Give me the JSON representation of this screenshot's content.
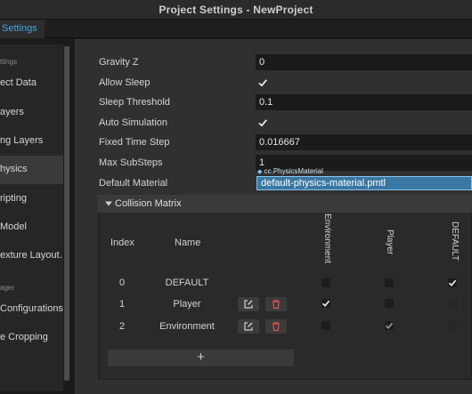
{
  "window": {
    "title": "Project Settings - NewProject"
  },
  "tab": {
    "label": "Settings"
  },
  "sidebar": {
    "section_project": "ttings",
    "section_manager": "ager",
    "items": [
      {
        "label": "ect Data"
      },
      {
        "label": "ayers"
      },
      {
        "label": "ng Layers"
      },
      {
        "label": "hysics"
      },
      {
        "label": "ripting"
      },
      {
        "label": "Model"
      },
      {
        "label": "exture Layout…"
      },
      {
        "label": " Configurations…"
      },
      {
        "label": "e Cropping"
      }
    ],
    "active_index": 3
  },
  "physics": {
    "gravity_z": {
      "label": "Gravity Z",
      "value": "0"
    },
    "allow_sleep": {
      "label": "Allow Sleep",
      "checked": true
    },
    "sleep_threshold": {
      "label": "Sleep Threshold",
      "value": "0.1"
    },
    "auto_simulation": {
      "label": "Auto Simulation",
      "checked": true
    },
    "fixed_time_step": {
      "label": "Fixed Time Step",
      "value": "0.016667"
    },
    "max_substeps": {
      "label": "Max SubSteps",
      "value": "1"
    },
    "default_material": {
      "label": "Default Material",
      "type": "cc.PhysicsMaterial",
      "value": "default-physics-material.pmtl"
    }
  },
  "collision_matrix": {
    "title": "Collision Matrix",
    "col_index": "Index",
    "col_name": "Name",
    "groups": [
      "Environment",
      "Player",
      "DEFAULT"
    ],
    "rows": [
      {
        "index": "0",
        "name": "DEFAULT",
        "editable": false,
        "checks": [
          false,
          false,
          true
        ]
      },
      {
        "index": "1",
        "name": "Player",
        "editable": true,
        "checks": [
          true,
          false,
          null
        ]
      },
      {
        "index": "2",
        "name": "Environment",
        "editable": true,
        "checks": [
          false,
          true,
          null
        ]
      }
    ],
    "add_label": "+"
  },
  "colors": {
    "accent": "#47a4e0",
    "selection": "#3a78a3",
    "delete": "#d9534f"
  }
}
